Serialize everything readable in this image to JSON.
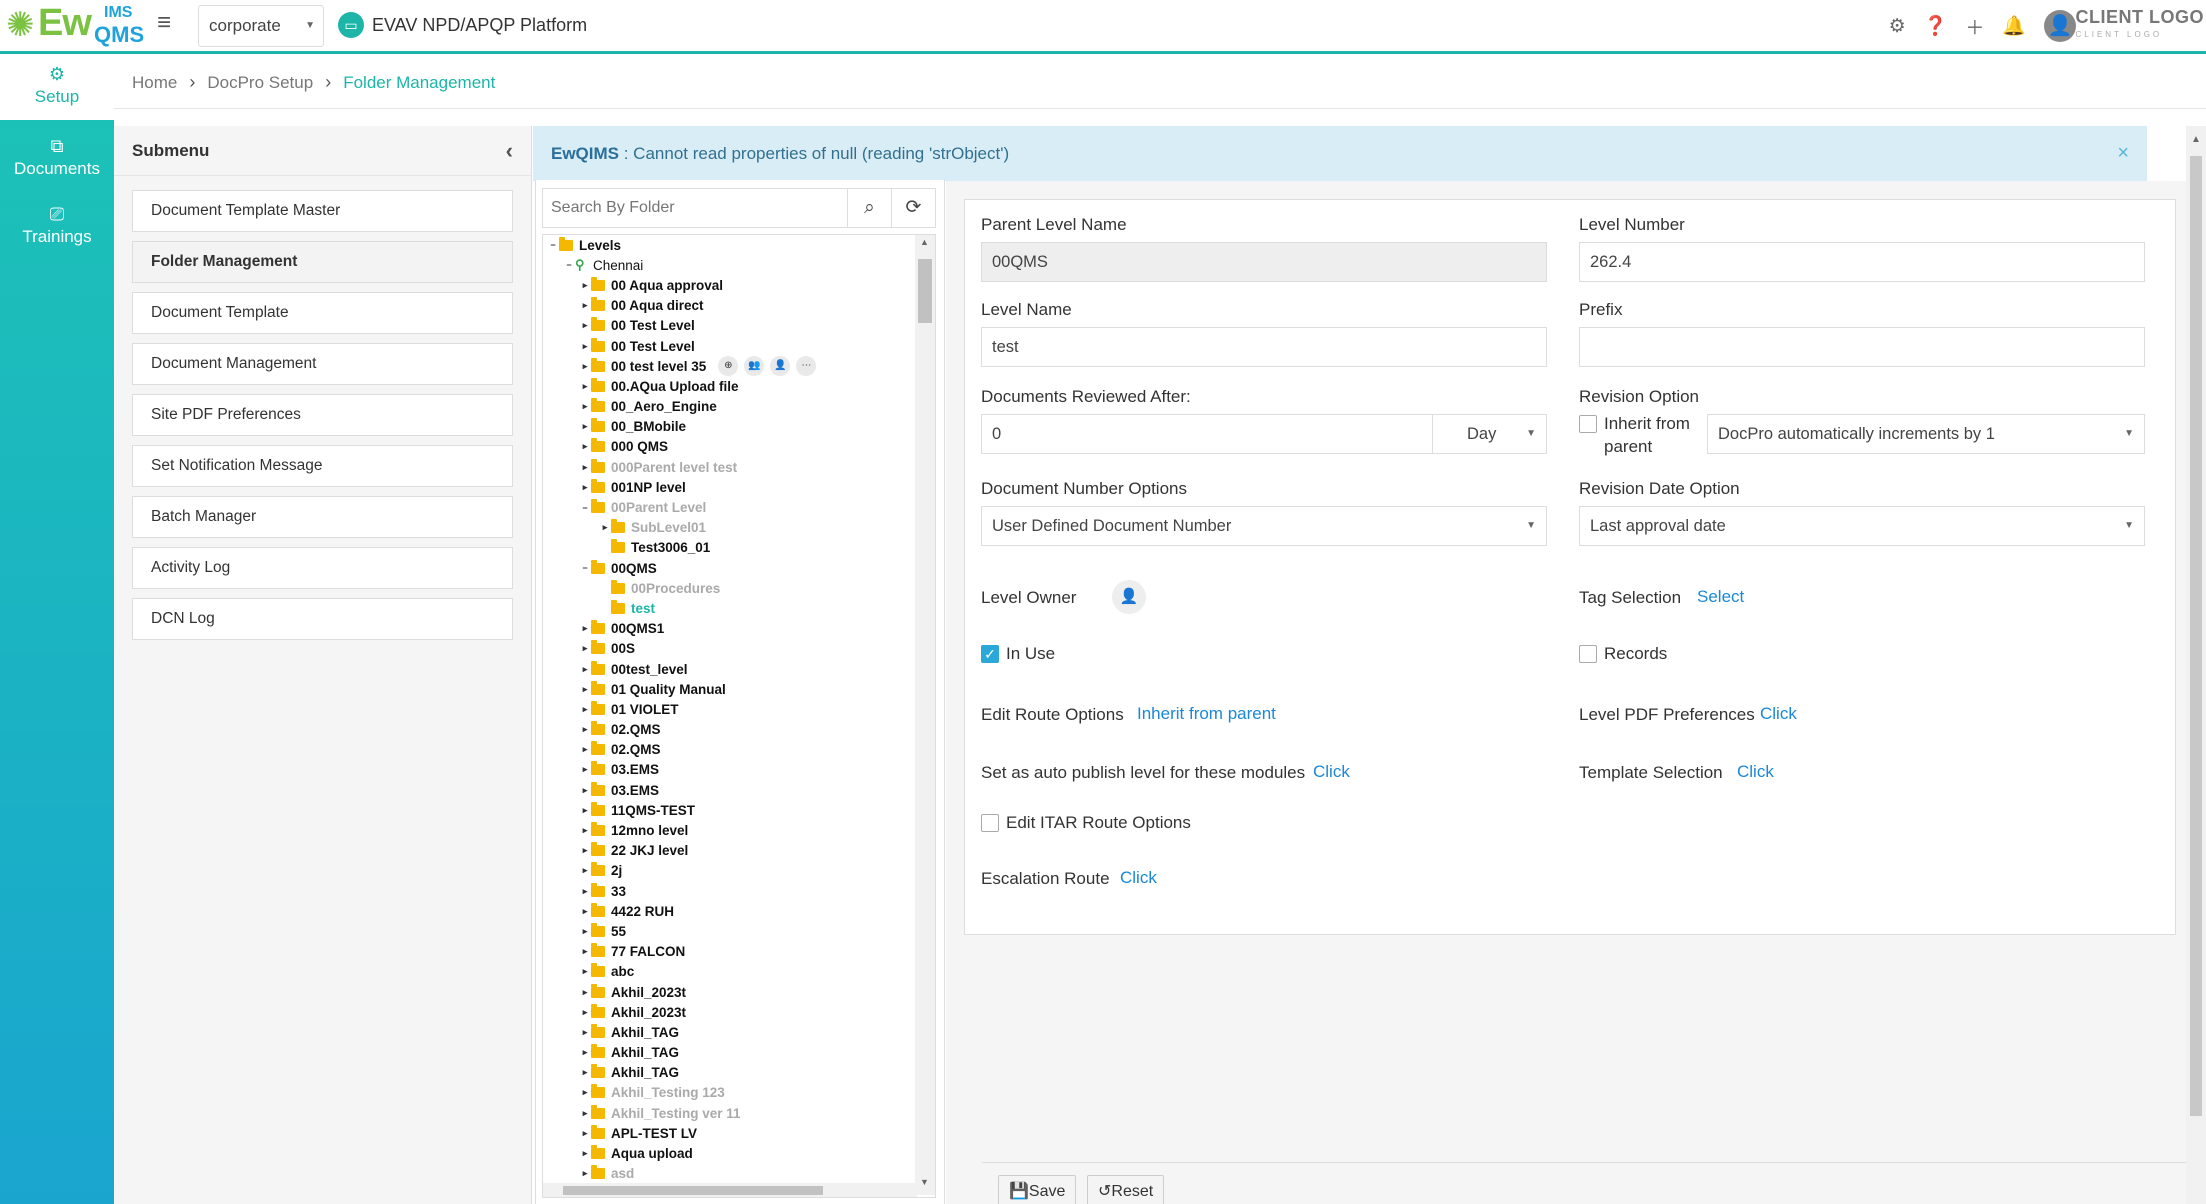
{
  "header": {
    "logo_text_ew": "Ew",
    "logo_text_ims": "IMS",
    "logo_text_qms": "QMS",
    "org_select": "corporate",
    "platform_name": "EVAV NPD/APQP Platform",
    "client_logo": "CLIENT LOGO",
    "client_logo_sub": "CLIENT LOGO"
  },
  "rail": {
    "items": [
      {
        "label": "Setup",
        "icon": "cogs-icon",
        "active": true
      },
      {
        "label": "Documents",
        "icon": "copy-icon",
        "active": false
      },
      {
        "label": "Trainings",
        "icon": "presentation-icon",
        "active": false
      }
    ]
  },
  "breadcrumb": {
    "home": "Home",
    "section": "DocPro Setup",
    "current": "Folder Management"
  },
  "submenu": {
    "title": "Submenu",
    "items": [
      "Document Template Master",
      "Folder Management",
      "Document Template",
      "Document Management",
      "Site PDF Preferences",
      "Set Notification Message",
      "Batch Manager",
      "Activity Log",
      "DCN Log"
    ]
  },
  "alert": {
    "source": "EwQIMS",
    "message": " : Cannot read properties of null (reading 'strObject')",
    "close": "×"
  },
  "tree": {
    "search_placeholder": "Search By Folder",
    "root": "Levels",
    "site": "Chennai",
    "nodes": [
      {
        "label": "00 Aqua approval",
        "depth": 2,
        "exp": "+"
      },
      {
        "label": "00 Aqua direct",
        "depth": 2,
        "exp": "+"
      },
      {
        "label": "00 Test Level",
        "depth": 2,
        "exp": "+"
      },
      {
        "label": "00 Test Level",
        "depth": 2,
        "exp": "+"
      },
      {
        "label": "00 test level 35",
        "depth": 2,
        "exp": "+",
        "actions": true
      },
      {
        "label": "00.AQua Upload file",
        "depth": 2,
        "exp": "+"
      },
      {
        "label": "00_Aero_Engine",
        "depth": 2,
        "exp": "+"
      },
      {
        "label": "00_BMobile",
        "depth": 2,
        "exp": "+"
      },
      {
        "label": "000 QMS",
        "depth": 2,
        "exp": "+"
      },
      {
        "label": "000Parent level test",
        "depth": 2,
        "exp": "+",
        "faded": true
      },
      {
        "label": "001NP level",
        "depth": 2,
        "exp": "+"
      },
      {
        "label": "00Parent Level",
        "depth": 2,
        "exp": "-",
        "faded": true
      },
      {
        "label": "SubLevel01",
        "depth": 3,
        "exp": "+",
        "faded": true
      },
      {
        "label": "Test3006_01",
        "depth": 3,
        "exp": ""
      },
      {
        "label": "00QMS",
        "depth": 2,
        "exp": "-"
      },
      {
        "label": "00Procedures",
        "depth": 3,
        "exp": "",
        "faded": true
      },
      {
        "label": "test",
        "depth": 3,
        "exp": "",
        "sel": true
      },
      {
        "label": "00QMS1",
        "depth": 2,
        "exp": "+"
      },
      {
        "label": "00S",
        "depth": 2,
        "exp": "+"
      },
      {
        "label": "00test_level",
        "depth": 2,
        "exp": "+"
      },
      {
        "label": "01 Quality Manual",
        "depth": 2,
        "exp": "+"
      },
      {
        "label": "01 VIOLET",
        "depth": 2,
        "exp": "+"
      },
      {
        "label": "02.QMS",
        "depth": 2,
        "exp": "+"
      },
      {
        "label": "02.QMS",
        "depth": 2,
        "exp": "+"
      },
      {
        "label": "03.EMS",
        "depth": 2,
        "exp": "+"
      },
      {
        "label": "03.EMS",
        "depth": 2,
        "exp": "+"
      },
      {
        "label": "11QMS-TEST",
        "depth": 2,
        "exp": "+"
      },
      {
        "label": "12mno level",
        "depth": 2,
        "exp": "+"
      },
      {
        "label": "22 JKJ level",
        "depth": 2,
        "exp": "+"
      },
      {
        "label": "2j",
        "depth": 2,
        "exp": "+"
      },
      {
        "label": "33",
        "depth": 2,
        "exp": "+"
      },
      {
        "label": "4422 RUH",
        "depth": 2,
        "exp": "+"
      },
      {
        "label": "55",
        "depth": 2,
        "exp": "+"
      },
      {
        "label": "77 FALCON",
        "depth": 2,
        "exp": "+"
      },
      {
        "label": "abc",
        "depth": 2,
        "exp": "+"
      },
      {
        "label": "Akhil_2023t",
        "depth": 2,
        "exp": "+"
      },
      {
        "label": "Akhil_2023t",
        "depth": 2,
        "exp": "+"
      },
      {
        "label": "Akhil_TAG",
        "depth": 2,
        "exp": "+"
      },
      {
        "label": "Akhil_TAG",
        "depth": 2,
        "exp": "+"
      },
      {
        "label": "Akhil_TAG",
        "depth": 2,
        "exp": "+"
      },
      {
        "label": "Akhil_Testing 123",
        "depth": 2,
        "exp": "+",
        "faded": true
      },
      {
        "label": "Akhil_Testing ver 11",
        "depth": 2,
        "exp": "+",
        "faded": true
      },
      {
        "label": "APL-TEST LV",
        "depth": 2,
        "exp": "+"
      },
      {
        "label": "Aqua upload",
        "depth": 2,
        "exp": "+"
      },
      {
        "label": "asd",
        "depth": 2,
        "exp": "+",
        "faded": true
      }
    ]
  },
  "form": {
    "parent_level_name_label": "Parent Level Name",
    "parent_level_name": "00QMS",
    "level_number_label": "Level Number",
    "level_number": "262.4",
    "level_name_label": "Level Name",
    "level_name": "test",
    "prefix_label": "Prefix",
    "prefix": "",
    "docs_reviewed_label": "Documents Reviewed After:",
    "docs_reviewed_value": "0",
    "docs_reviewed_unit": "Day",
    "revision_option_label": "Revision Option",
    "inherit_label_1": "Inherit from",
    "inherit_label_2": "parent",
    "revision_option_value": "DocPro automatically increments by 1",
    "doc_number_options_label": "Document Number Options",
    "doc_number_options_value": "User Defined Document Number",
    "revision_date_option_label": "Revision Date Option",
    "revision_date_option_value": "Last approval date",
    "level_owner_label": "Level Owner",
    "tag_selection_label": "Tag Selection",
    "tag_selection_link": "Select",
    "in_use_label": "In Use",
    "records_label": "Records",
    "edit_route_label": "Edit Route Options",
    "edit_route_link": "Inherit from parent",
    "level_pdf_label": "Level PDF Preferences",
    "level_pdf_link": "Click",
    "auto_publish_label": "Set as auto publish level for these modules",
    "auto_publish_link": "Click",
    "template_selection_label": "Template Selection",
    "template_selection_link": "Click",
    "edit_itar_label": "Edit ITAR Route Options",
    "escalation_label": "Escalation Route",
    "escalation_link": "Click",
    "save_label": "Save",
    "reset_label": "Reset"
  }
}
